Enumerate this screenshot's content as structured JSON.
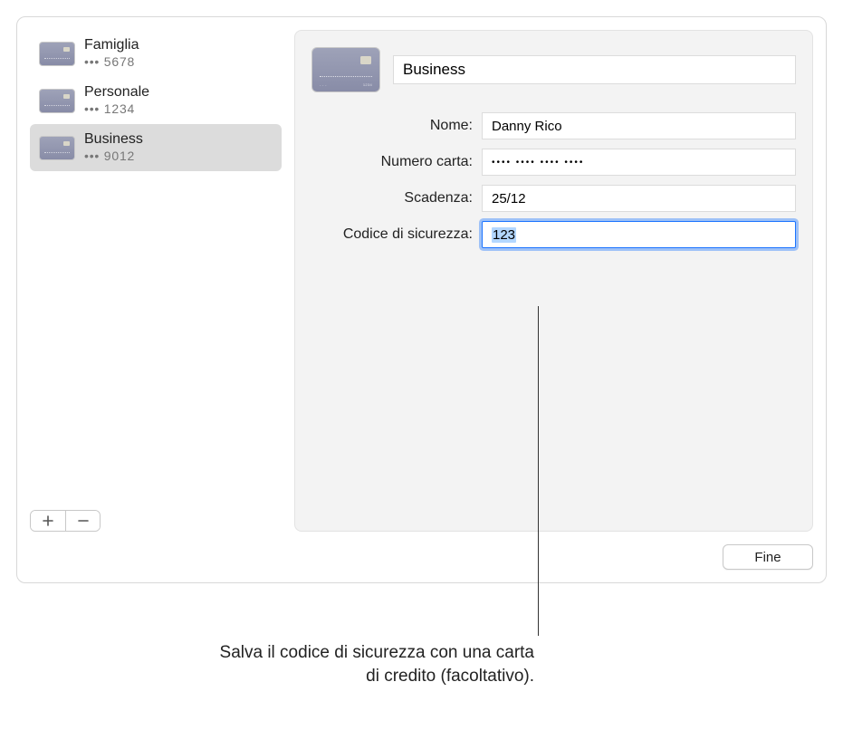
{
  "sidebar": {
    "items": [
      {
        "name": "Famiglia",
        "digits": "••• 5678",
        "selected": false
      },
      {
        "name": "Personale",
        "digits": "••• 1234",
        "selected": false
      },
      {
        "name": "Business",
        "digits": "••• 9012",
        "selected": true
      }
    ]
  },
  "detail": {
    "title_value": "Business",
    "labels": {
      "name": "Nome:",
      "number": "Numero carta:",
      "expiry": "Scadenza:",
      "security": "Codice di sicurezza:"
    },
    "values": {
      "name": "Danny Rico",
      "number": "•••• •••• •••• ••••",
      "expiry": "25/12",
      "security": "123"
    }
  },
  "buttons": {
    "done": "Fine"
  },
  "callout": "Salva il codice di sicurezza con una carta di credito (facoltativo)."
}
